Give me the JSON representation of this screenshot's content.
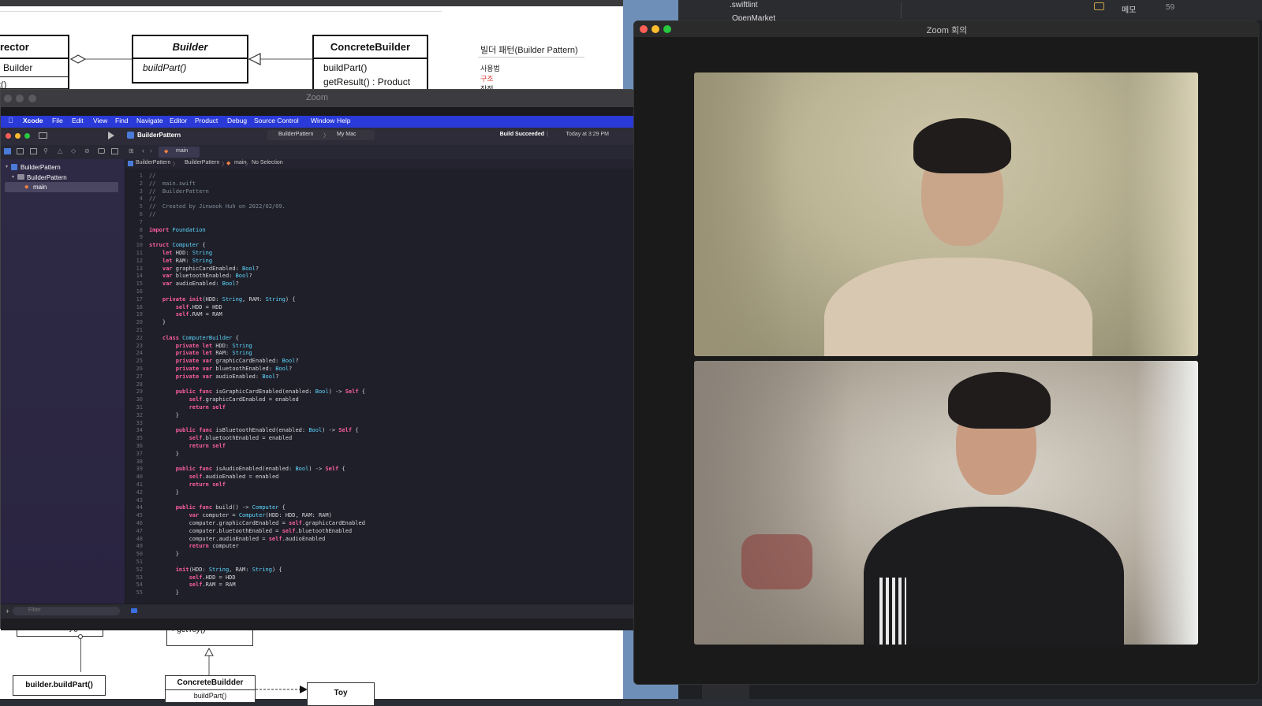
{
  "background_doc": {
    "uml": {
      "director_title": "rector",
      "director_row": "Builder",
      "director_method": "t()",
      "builder_title": "Builder",
      "builder_method": "buildPart()",
      "concrete_title": "ConcreteBuilder",
      "concrete_method": "buildPart()",
      "concrete_result": "getResult() : Product"
    },
    "notes": {
      "title": "빌더 패턴(Builder Pattern)",
      "item1": "사용법",
      "item2": "구조",
      "item3": "장점"
    },
    "lower_diagram": {
      "construct": "+ constructToy()",
      "get_toy": "+ getToy()",
      "build_part_note": "builder.buildPart()",
      "concrete": "ConcreteBuildder",
      "concrete_method": "buildPart()",
      "toy": "Toy"
    }
  },
  "right_strip": {
    "file": ".swiftlint",
    "folder": "OpenMarket",
    "memo": "메모",
    "count": "59"
  },
  "share_window": {
    "title": "Zoom",
    "menu": [
      "Xcode",
      "File",
      "Edit",
      "View",
      "Find",
      "Navigate",
      "Editor",
      "Product",
      "Debug",
      "Source Control",
      "Window",
      "Help"
    ],
    "project": "BuilderPattern",
    "scheme": "BuilderPattern",
    "destination": "My Mac",
    "build_status": "Build Succeeded",
    "build_time": "Today at 3:29 PM",
    "tab": "main",
    "breadcrumb": [
      "BuilderPattern",
      "BuilderPattern",
      "main",
      "No Selection"
    ],
    "navigator": [
      "BuilderPattern",
      "BuilderPattern",
      "main"
    ],
    "filter_placeholder": "Filter",
    "code": [
      "//",
      "//  main.swift",
      "//  BuilderPattern",
      "//",
      "//  Created by Jinwook Huh on 2022/02/09.",
      "//",
      "",
      "import Foundation",
      "",
      "struct Computer {",
      "    let HDD: String",
      "    let RAM: String",
      "    var graphicCardEnabled: Bool?",
      "    var bluetoothEnabled: Bool?",
      "    var audioEnabled: Bool?",
      "",
      "    private init(HDD: String, RAM: String) {",
      "        self.HDD = HDD",
      "        self.RAM = RAM",
      "    }",
      "",
      "    class ComputerBuilder {",
      "        private let HDD: String",
      "        private let RAM: String",
      "        private var graphicCardEnabled: Bool?",
      "        private var bluetoothEnabled: Bool?",
      "        private var audioEnabled: Bool?",
      "",
      "        public func isGraphicCardEnabled(enabled: Bool) -> Self {",
      "            self.graphicCardEnabled = enabled",
      "            return self",
      "        }",
      "",
      "        public func isBluetoothEnabled(enabled: Bool) -> Self {",
      "            self.bluetoothEnabled = enabled",
      "            return self",
      "        }",
      "",
      "        public func isAudioEnabled(enabled: Bool) -> Self {",
      "            self.audioEnabled = enabled",
      "            return self",
      "        }",
      "",
      "        public func build() -> Computer {",
      "            var computer = Computer(HDD: HDD, RAM: RAM)",
      "            computer.graphicCardEnabled = self.graphicCardEnabled",
      "            computer.bluetoothEnabled = self.bluetoothEnabled",
      "            computer.audioEnabled = self.audioEnabled",
      "            return computer",
      "        }",
      "",
      "        init(HDD: String, RAM: String) {",
      "            self.HDD = HDD",
      "            self.RAM = RAM",
      "        }"
    ]
  },
  "zoom_meeting": {
    "title": "Zoom 회의"
  },
  "colors": {
    "menubar": "#2a3ad8",
    "close": "#ff5f57",
    "minimize": "#febc2e",
    "maximize": "#28c840"
  }
}
